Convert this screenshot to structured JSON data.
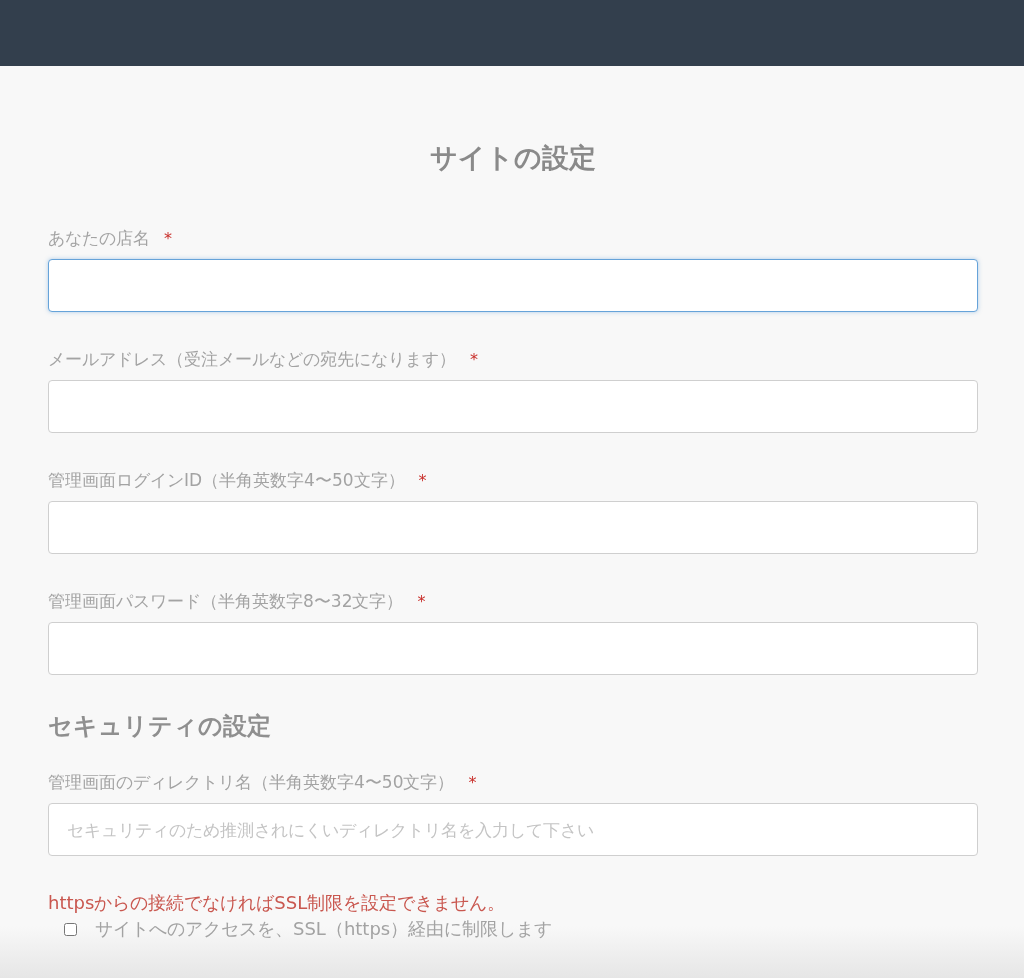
{
  "title": "サイトの設定",
  "items": [
    {
      "kind": "field",
      "label": "あなたの店名",
      "mark": "*",
      "focused": true
    },
    {
      "kind": "field",
      "label": "メールアドレス（受注メールなどの宛先になります）",
      "mark": "*",
      "focused": false
    },
    {
      "kind": "field",
      "label": "管理画面ログインID（半角英数字4〜50文字）",
      "mark": "*",
      "focused": false
    },
    {
      "kind": "field",
      "label": "管理画面パスワード（半角英数字8〜32文字）",
      "mark": "*",
      "focused": false
    },
    {
      "kind": "heading",
      "text": "セキュリティの設定"
    },
    {
      "kind": "field",
      "label": "管理画面のディレクトリ名（半角英数字4〜50文字）",
      "mark": "*",
      "placeholder": "セキュリティのため推測されにくいディレクトリ名を入力して下さい",
      "focused": false
    },
    {
      "kind": "warning",
      "text": "httpsからの接続でなければSSL制限を設定できません。"
    },
    {
      "kind": "checkbox",
      "label": "サイトへのアクセスを、SSL（https）経由に制限します",
      "checked": false
    }
  ]
}
